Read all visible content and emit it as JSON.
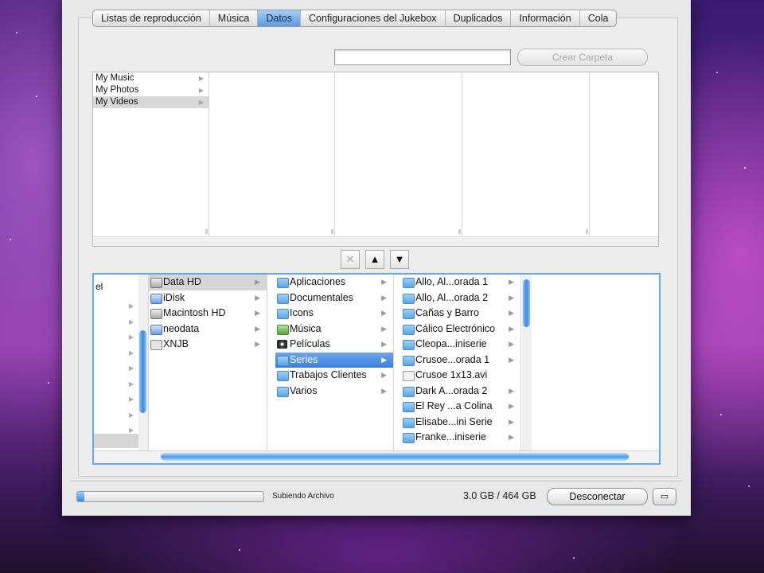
{
  "tabs": [
    {
      "label": "Listas de reproducción"
    },
    {
      "label": "Música"
    },
    {
      "label": "Datos",
      "active": true
    },
    {
      "label": "Configuraciones del Jukebox"
    },
    {
      "label": "Duplicados"
    },
    {
      "label": "Información"
    },
    {
      "label": "Cola"
    }
  ],
  "toolbar": {
    "folder_name_value": "",
    "create_folder_label": "Crear Carpeta"
  },
  "device_browser": {
    "column1": [
      {
        "label": "My Music"
      },
      {
        "label": "My Photos"
      },
      {
        "label": "My Videos",
        "selected": true
      }
    ]
  },
  "transfer_buttons": {
    "delete_icon": "✕",
    "upload_icon": "▲",
    "download_icon": "▼"
  },
  "local_browser": {
    "col0_label_fragment": "el",
    "volumes": [
      {
        "label": "Data HD",
        "icon": "drive-icon",
        "selected": true
      },
      {
        "label": "iDisk",
        "icon": "idisk-icon"
      },
      {
        "label": "Macintosh HD",
        "icon": "drive-icon"
      },
      {
        "label": "neodata",
        "icon": "network-drive-icon"
      },
      {
        "label": "XNJB",
        "icon": "app-icon"
      }
    ],
    "folders": [
      {
        "label": "Aplicaciones",
        "icon": "folder-icon"
      },
      {
        "label": "Documentales",
        "icon": "folder-icon"
      },
      {
        "label": "Icons",
        "icon": "folder-icon"
      },
      {
        "label": "Música",
        "icon": "music-folder-icon"
      },
      {
        "label": "Películas",
        "icon": "movies-folder-icon"
      },
      {
        "label": "Series",
        "icon": "folder-icon",
        "selected": true
      },
      {
        "label": "Trabajos Clientes",
        "icon": "folder-icon"
      },
      {
        "label": "Varios",
        "icon": "folder-icon"
      }
    ],
    "series": [
      {
        "label": "Allo, Al...orada 1",
        "icon": "folder-icon"
      },
      {
        "label": "Allo, Al...orada 2",
        "icon": "folder-icon"
      },
      {
        "label": "Cañas y Barro",
        "icon": "folder-icon"
      },
      {
        "label": "Cálico Electrónico",
        "icon": "folder-icon"
      },
      {
        "label": "Cleopa...iniserie",
        "icon": "folder-icon"
      },
      {
        "label": "Crusoe...orada 1",
        "icon": "folder-icon"
      },
      {
        "label": "Crusoe 1x13.avi",
        "icon": "video-file-icon"
      },
      {
        "label": "Dark A...orada 2",
        "icon": "folder-icon"
      },
      {
        "label": "El Rey ...a Colina",
        "icon": "folder-icon"
      },
      {
        "label": "Elisabe...ini Serie",
        "icon": "folder-icon"
      },
      {
        "label": "Franke...iniserie",
        "icon": "folder-icon"
      }
    ]
  },
  "status": {
    "progress": 0.04,
    "text": "Subiendo Archivo",
    "capacity": "3.0 GB / 464 GB",
    "disconnect_label": "Desconectar"
  },
  "colors": {
    "selection_blue": "#3b7fde",
    "focus_ring": "#6aa7e8",
    "window_bg": "#e8e8e8"
  }
}
